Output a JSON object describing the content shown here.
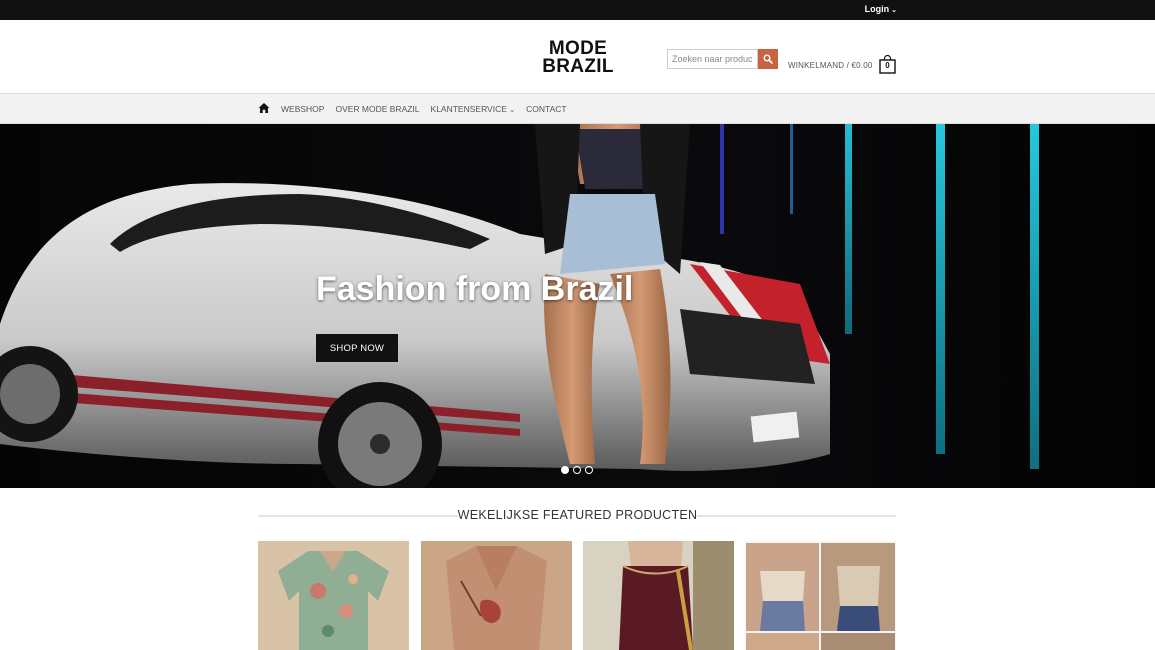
{
  "topbar": {
    "login_label": "Login"
  },
  "header": {
    "logo_line1": "MODE",
    "logo_line2": "BRAZIL",
    "search_placeholder": "Zoeken naar producten",
    "cart_label": "WINKELMAND / €0.00",
    "cart_count": "0"
  },
  "nav": {
    "items": [
      "WEBSHOP",
      "OVER MODE BRAZIL",
      "KLANTENSERVICE",
      "CONTACT"
    ]
  },
  "hero": {
    "title": "Fashion from Brazil",
    "button_label": "SHOP NOW",
    "slides_total": 3,
    "active_slide": 1
  },
  "featured": {
    "title": "WEKELIJKSE FEATURED PRODUCTEN"
  },
  "colors": {
    "accent": "#c9633f",
    "topbar": "#111111",
    "nav_bg": "#f2f2f2"
  }
}
